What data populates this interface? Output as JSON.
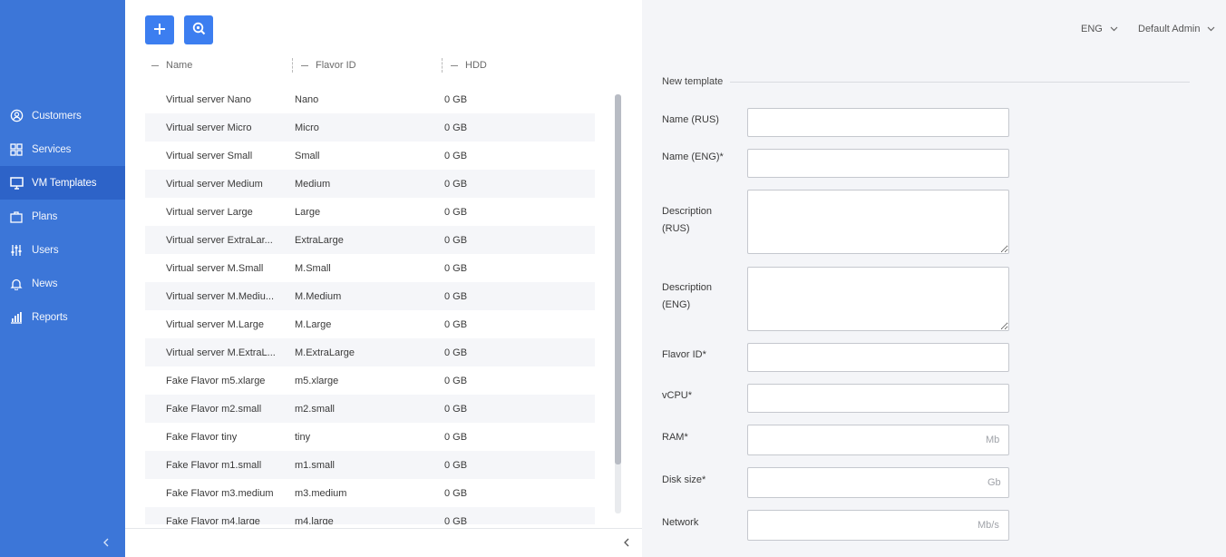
{
  "sidebar": {
    "items": [
      {
        "label": "Customers",
        "icon": "user-circle-icon",
        "active": false
      },
      {
        "label": "Services",
        "icon": "grid-icon",
        "active": false
      },
      {
        "label": "VM Templates",
        "icon": "monitor-icon",
        "active": true
      },
      {
        "label": "Plans",
        "icon": "briefcase-icon",
        "active": false
      },
      {
        "label": "Users",
        "icon": "sliders-icon",
        "active": false
      },
      {
        "label": "News",
        "icon": "bell-icon",
        "active": false
      },
      {
        "label": "Reports",
        "icon": "bar-chart-icon",
        "active": false
      }
    ],
    "collapse_icon": "chevron-left-icon"
  },
  "toolbar": {
    "add_icon": "plus-icon",
    "search_icon": "search-icon"
  },
  "table": {
    "columns": [
      "Name",
      "Flavor ID",
      "HDD"
    ],
    "rows": [
      [
        "Virtual server Nano",
        "Nano",
        "0 GB"
      ],
      [
        "Virtual server Micro",
        "Micro",
        "0 GB"
      ],
      [
        "Virtual server Small",
        "Small",
        "0 GB"
      ],
      [
        "Virtual server Medium",
        "Medium",
        "0 GB"
      ],
      [
        "Virtual server Large",
        "Large",
        "0 GB"
      ],
      [
        "Virtual server ExtraLar...",
        "ExtraLarge",
        "0 GB"
      ],
      [
        "Virtual server M.Small",
        "M.Small",
        "0 GB"
      ],
      [
        "Virtual server M.Mediu...",
        "M.Medium",
        "0 GB"
      ],
      [
        "Virtual server M.Large",
        "M.Large",
        "0 GB"
      ],
      [
        "Virtual server M.ExtraL...",
        "M.ExtraLarge",
        "0 GB"
      ],
      [
        "Fake Flavor m5.xlarge",
        "m5.xlarge",
        "0 GB"
      ],
      [
        "Fake Flavor m2.small",
        "m2.small",
        "0 GB"
      ],
      [
        "Fake Flavor tiny",
        "tiny",
        "0 GB"
      ],
      [
        "Fake Flavor m1.small",
        "m1.small",
        "0 GB"
      ],
      [
        "Fake Flavor m3.medium",
        "m3.medium",
        "0 GB"
      ],
      [
        "Fake Flavor m4.large",
        "m4.large",
        "0 GB"
      ]
    ]
  },
  "topbar": {
    "language": "ENG",
    "user": "Default Admin"
  },
  "form": {
    "title": "New template",
    "fields": {
      "name_rus": {
        "label": "Name (RUS)",
        "value": ""
      },
      "name_eng": {
        "label": "Name (ENG)*",
        "value": ""
      },
      "desc_rus": {
        "label": "Description (RUS)",
        "value": ""
      },
      "desc_eng": {
        "label": "Description (ENG)",
        "value": ""
      },
      "flavor_id": {
        "label": "Flavor ID*",
        "value": ""
      },
      "vcpu": {
        "label": "vCPU*",
        "value": ""
      },
      "ram": {
        "label": "RAM*",
        "value": "",
        "unit": "Mb"
      },
      "disk": {
        "label": "Disk size*",
        "value": "",
        "unit": "Gb"
      },
      "network": {
        "label": "Network",
        "value": "",
        "unit": "Mb/s"
      }
    }
  },
  "colors": {
    "sidebar_bg": "#3c76d8",
    "sidebar_active": "#2d63c8",
    "accent_button": "#3c7ef0",
    "panel_bg": "#f4f5f8"
  }
}
